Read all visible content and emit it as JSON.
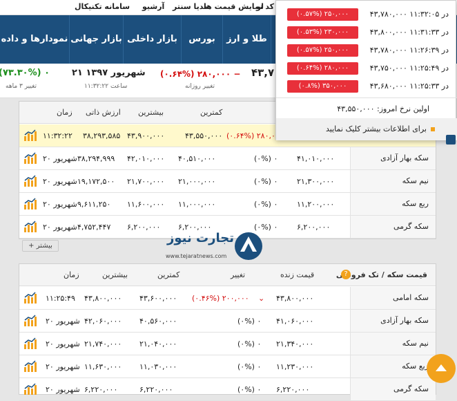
{
  "topbar": {
    "links": [
      "سامانه تکنیکال",
      "آرشیو",
      "مدیا سنتر",
      "کد نمایش قیمت ها",
      "لو"
    ]
  },
  "nav": {
    "items": [
      "نمودارها و داده",
      "بازار جهانی",
      "بازار داخلی",
      "بورس",
      "طلا و ارز"
    ]
  },
  "ticker": {
    "value1": "۴۳,۷",
    "change1": "(۰.۶۴%) ۲۸۰,۰۰۰ −",
    "change1_label": "تغییر روزانه",
    "date": "۲۱ شهریور ۱۳۹۷",
    "time": "ساعت ۱۱:۳۲:۲۲",
    "change2": "(۷۳.۳۰%) ۰",
    "change2_label": "تغییر ۳ ماهه"
  },
  "table1": {
    "headers": [
      "زمان",
      "ارزش ذاتی",
      "بیشترین",
      "کمترین"
    ],
    "first_row": {
      "change": "(۰.۶۴%) ۲۸۰,۰۰۰",
      "low": "۴۳,۵۵۰,۰۰۰",
      "high": "۴۳,۹۰۰,۰۰۰",
      "value": "۳۸,۲۹۳,۵۸۵",
      "time": "۱۱:۳۲:۲۲"
    },
    "rows": [
      {
        "label": "سکه بهار آزادی",
        "price": "۴۱,۰۱۰,۰۰۰",
        "change": "(۰%) ۰",
        "low": "۴۰,۵۱۰,۰۰۰",
        "high": "۴۲,۰۱۰,۰۰۰",
        "value": "۳۸,۲۹۴,۹۹۹",
        "time": "۲۰ شهریور"
      },
      {
        "label": "نیم سکه",
        "price": "۲۱,۳۰۰,۰۰۰",
        "change": "(۰%) ۰",
        "low": "۲۱,۰۰۰,۰۰۰",
        "high": "۲۱,۷۰۰,۰۰۰",
        "value": "۱۹,۱۷۲,۵۰۰",
        "time": "۲۰ شهریور"
      },
      {
        "label": "ربع سکه",
        "price": "۱۱,۲۰۰,۰۰۰",
        "change": "(۰%) ۰",
        "low": "۱۱,۰۰۰,۰۰۰",
        "high": "۱۱,۶۰۰,۰۰۰",
        "value": "۹,۶۱۱,۲۵۰",
        "time": "۲۰ شهریور"
      },
      {
        "label": "سکه گرمی",
        "price": "۶,۲۰۰,۰۰۰",
        "change": "(۰%) ۰",
        "low": "۶,۲۰۰,۰۰۰",
        "high": "۶,۲۰۰,۰۰۰",
        "value": "۴,۷۵۲,۴۴۷",
        "time": "۲۰ شهریور"
      }
    ],
    "more": "بیشتر"
  },
  "table2": {
    "title": "قیمت سکه / تک فروشی",
    "headers": [
      "قیمت زنده",
      "تغییر",
      "کمترین",
      "بیشترین",
      "زمان"
    ],
    "rows": [
      {
        "label": "سکه امامی",
        "price": "۴۳,۸۰۰,۰۰۰",
        "change": "(۰.۴۶%) ۲۰۰,۰۰۰",
        "down": true,
        "low": "۴۳,۶۰۰,۰۰۰",
        "high": "۴۳,۸۰۰,۰۰۰",
        "time": "۱۱:۲۵:۴۹"
      },
      {
        "label": "سکه بهار آزادی",
        "price": "۴۱,۰۶۰,۰۰۰",
        "change": "(۰%) ۰",
        "low": "۴۰,۵۶۰,۰۰۰",
        "high": "۴۲,۰۶۰,۰۰۰",
        "time": "۲۰ شهریور"
      },
      {
        "label": "نیم سکه",
        "price": "۲۱,۳۴۰,۰۰۰",
        "change": "(۰%) ۰",
        "low": "۲۱,۰۴۰,۰۰۰",
        "high": "۲۱,۷۴۰,۰۰۰",
        "time": "۲۰ شهریور"
      },
      {
        "label": "ربع سکه",
        "price": "۱۱,۲۳۰,۰۰۰",
        "change": "(۰%) ۰",
        "low": "۱۱,۰۳۰,۰۰۰",
        "high": "۱۱,۶۳۰,۰۰۰",
        "time": "۲۰ شهریور"
      },
      {
        "label": "سکه گرمی",
        "price": "۶,۲۲۰,۰۰۰",
        "change": "(۰%) ۰",
        "low": "۶,۲۲۰,۰۰۰",
        "high": "۶,۲۲۰,۰۰۰",
        "time": "۲۰ شهریور"
      }
    ]
  },
  "dropdown": {
    "rows": [
      {
        "badge": "(۰.۵۷%) ۲۵۰,۰۰۰",
        "text": "۴۳,۷۸۰,۰۰۰ در ۱۱:۳۲:۰۵"
      },
      {
        "badge": "(۰.۵۳%) ۲۳۰,۰۰۰",
        "text": "۴۳,۸۰۰,۰۰۰ در ۱۱:۳۱:۳۳"
      },
      {
        "badge": "(۰.۵۷%) ۲۵۰,۰۰۰",
        "text": "۴۳,۷۸۰,۰۰۰ در ۱۱:۲۶:۳۹"
      },
      {
        "badge": "(۰.۶۴%) ۲۸۰,۰۰۰",
        "text": "۴۳,۷۵۰,۰۰۰ در ۱۱:۲۵:۴۹"
      },
      {
        "badge": "(۰.۸%) ۳۵۰,۰۰۰",
        "text": "۴۳,۶۸۰,۰۰۰ در ۱۱:۲۵:۳۳"
      }
    ],
    "first_rate": "اولین نرخ امروز: ۴۳,۵۵۰,۰۰۰",
    "more_info": "برای اطلاعات بیشتر کلیک نمایید"
  },
  "logo": {
    "name": "تجارت نیوز",
    "url": "www.tejaratnews.com"
  },
  "colors": {
    "nav": "#1c4f7d",
    "badge": "#e8303a",
    "highlight": "#fff9cc",
    "accent": "#f2a21c"
  }
}
